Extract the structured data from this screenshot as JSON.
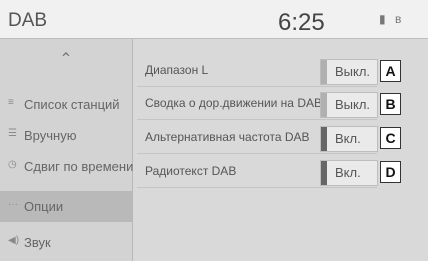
{
  "header": {
    "title": "DAB",
    "time": "6:25"
  },
  "status_icons": [
    "battery-icon",
    "bluetooth-icon"
  ],
  "sidebar": {
    "items": [
      {
        "label": "Список станций",
        "icon": "list-icon"
      },
      {
        "label": "Вручную",
        "icon": "manual-icon"
      },
      {
        "label": "Сдвиг по времени",
        "icon": "clock-icon"
      },
      {
        "label": "Опции",
        "icon": "options-icon",
        "active": true
      },
      {
        "label": "Звук",
        "icon": "speaker-icon"
      }
    ]
  },
  "settings": [
    {
      "label": "Диапазон L",
      "value": "Выкл.",
      "state": "off",
      "marker": "A"
    },
    {
      "label": "Сводка о дор.движении на DAB",
      "value": "Выкл.",
      "state": "off",
      "marker": "B"
    },
    {
      "label": "Альтернативная частота DAB",
      "value": "Вкл.",
      "state": "on",
      "marker": "C"
    },
    {
      "label": "Радиотекст DAB",
      "value": "Вкл.",
      "state": "on",
      "marker": "D"
    }
  ]
}
